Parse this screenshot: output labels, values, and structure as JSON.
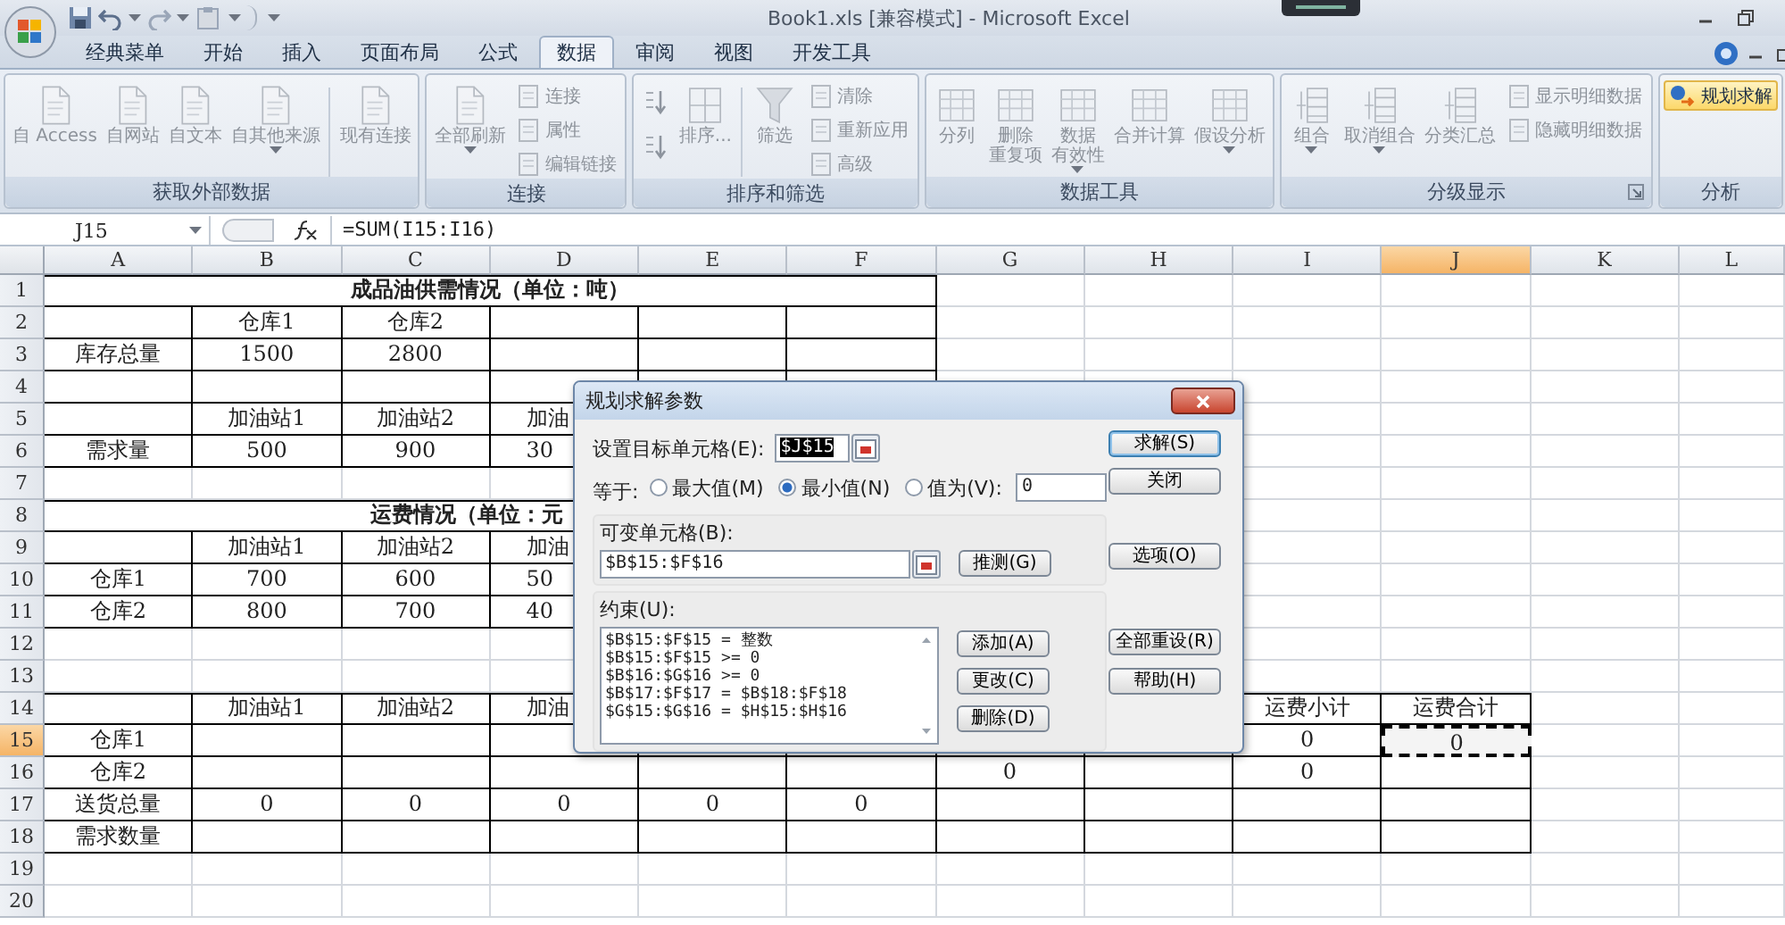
{
  "window": {
    "title": "Book1.xls  [兼容模式] - Microsoft Excel"
  },
  "tabs": [
    {
      "label": "经典菜单",
      "selected": false
    },
    {
      "label": "开始",
      "selected": false
    },
    {
      "label": "插入",
      "selected": false
    },
    {
      "label": "页面布局",
      "selected": false
    },
    {
      "label": "公式",
      "selected": false
    },
    {
      "label": "数据",
      "selected": true
    },
    {
      "label": "审阅",
      "selected": false
    },
    {
      "label": "视图",
      "selected": false
    },
    {
      "label": "开发工具",
      "selected": false
    }
  ],
  "ribbon_groups": [
    {
      "label": "获取外部数据",
      "launcher": false,
      "items": [
        {
          "kind": "large",
          "lines": [
            "自 Access"
          ],
          "disabled": true,
          "dropdown": false,
          "highlighted": false
        },
        {
          "kind": "large",
          "lines": [
            "自网站"
          ],
          "disabled": true,
          "dropdown": false,
          "highlighted": false
        },
        {
          "kind": "large",
          "lines": [
            "自文本"
          ],
          "disabled": true,
          "dropdown": false,
          "highlighted": false
        },
        {
          "kind": "large",
          "lines": [
            "自其他来源"
          ],
          "disabled": true,
          "dropdown": true,
          "highlighted": false
        },
        {
          "kind": "separator"
        },
        {
          "kind": "large",
          "lines": [
            "现有连接"
          ],
          "disabled": true,
          "dropdown": false,
          "highlighted": false
        }
      ]
    },
    {
      "label": "连接",
      "launcher": false,
      "items": [
        {
          "kind": "large",
          "lines": [
            "全部刷新"
          ],
          "disabled": true,
          "dropdown": true,
          "highlighted": false
        },
        {
          "kind": "small",
          "label": "连接",
          "disabled": true,
          "dropdown": false,
          "highlighted": false
        },
        {
          "kind": "small",
          "label": "属性",
          "disabled": true,
          "dropdown": false,
          "highlighted": false
        },
        {
          "kind": "small",
          "label": "编辑链接",
          "disabled": true,
          "dropdown": false,
          "highlighted": false
        }
      ]
    },
    {
      "label": "排序和筛选",
      "launcher": false,
      "items": [
        {
          "kind": "icon",
          "disabled": true,
          "highlighted": false
        },
        {
          "kind": "icon",
          "disabled": true,
          "highlighted": false
        },
        {
          "kind": "large",
          "lines": [
            "排序..."
          ],
          "disabled": true,
          "dropdown": false,
          "highlighted": false
        },
        {
          "kind": "separator"
        },
        {
          "kind": "large",
          "lines": [
            "筛选"
          ],
          "disabled": true,
          "dropdown": false,
          "highlighted": false
        },
        {
          "kind": "small",
          "label": "清除",
          "disabled": true,
          "dropdown": false,
          "highlighted": false
        },
        {
          "kind": "small",
          "label": "重新应用",
          "disabled": true,
          "dropdown": false,
          "highlighted": false
        },
        {
          "kind": "small",
          "label": "高级",
          "disabled": true,
          "dropdown": false,
          "highlighted": false
        }
      ]
    },
    {
      "label": "数据工具",
      "launcher": false,
      "items": [
        {
          "kind": "large",
          "lines": [
            "分列"
          ],
          "disabled": true,
          "dropdown": false,
          "highlighted": false
        },
        {
          "kind": "large",
          "lines": [
            "删除",
            "重复项"
          ],
          "disabled": true,
          "dropdown": false,
          "highlighted": false
        },
        {
          "kind": "large",
          "lines": [
            "数据",
            "有效性"
          ],
          "disabled": true,
          "dropdown": true,
          "highlighted": false
        },
        {
          "kind": "large",
          "lines": [
            "合并计算"
          ],
          "disabled": true,
          "dropdown": false,
          "highlighted": false
        },
        {
          "kind": "large",
          "lines": [
            "假设分析"
          ],
          "disabled": true,
          "dropdown": true,
          "highlighted": false
        }
      ]
    },
    {
      "label": "分级显示",
      "launcher": true,
      "items": [
        {
          "kind": "large",
          "lines": [
            "组合"
          ],
          "disabled": true,
          "dropdown": true,
          "highlighted": false
        },
        {
          "kind": "large",
          "lines": [
            "取消组合"
          ],
          "disabled": true,
          "dropdown": true,
          "highlighted": false
        },
        {
          "kind": "large",
          "lines": [
            "分类汇总"
          ],
          "disabled": true,
          "dropdown": false,
          "highlighted": false
        },
        {
          "kind": "small",
          "label": "显示明细数据",
          "disabled": true,
          "dropdown": false,
          "highlighted": false
        },
        {
          "kind": "small",
          "label": "隐藏明细数据",
          "disabled": true,
          "dropdown": false,
          "highlighted": false
        }
      ]
    },
    {
      "label": "分析",
      "launcher": false,
      "items": [
        {
          "kind": "small",
          "label": "规划求解",
          "disabled": false,
          "dropdown": false,
          "highlighted": true
        }
      ]
    }
  ],
  "name_box": "J15",
  "formula": "=SUM(I15:I16)",
  "columns": [
    {
      "label": "A",
      "selected": false
    },
    {
      "label": "B",
      "selected": false
    },
    {
      "label": "C",
      "selected": false
    },
    {
      "label": "D",
      "selected": false
    },
    {
      "label": "E",
      "selected": false
    },
    {
      "label": "F",
      "selected": false
    },
    {
      "label": "G",
      "selected": false
    },
    {
      "label": "H",
      "selected": false
    },
    {
      "label": "I",
      "selected": false
    },
    {
      "label": "J",
      "selected": true
    },
    {
      "label": "K",
      "selected": false
    },
    {
      "label": "L",
      "selected": false
    }
  ],
  "rows": [
    {
      "number": "1",
      "selected": false,
      "title": "成品油供需情况（单位：吨）"
    },
    {
      "number": "2",
      "selected": false,
      "cells": [
        null,
        {
          "text": "仓库1",
          "active": false
        },
        {
          "text": "仓库2",
          "active": false
        }
      ]
    },
    {
      "number": "3",
      "selected": false,
      "cells": [
        {
          "text": "库存总量",
          "active": false
        },
        {
          "text": "1500",
          "active": false
        },
        {
          "text": "2800",
          "active": false
        }
      ]
    },
    {
      "number": "4",
      "selected": false
    },
    {
      "number": "5",
      "selected": false,
      "cells": [
        null,
        {
          "text": "加油站1",
          "active": false
        },
        {
          "text": "加油站2",
          "active": false
        },
        {
          "text": "加油",
          "active": false
        }
      ]
    },
    {
      "number": "6",
      "selected": false,
      "cells": [
        {
          "text": "需求量",
          "active": false
        },
        {
          "text": "500",
          "active": false
        },
        {
          "text": "900",
          "active": false
        },
        {
          "text": "30",
          "active": false
        }
      ]
    },
    {
      "number": "7",
      "selected": false
    },
    {
      "number": "8",
      "selected": false,
      "title": "运费情况（单位：元"
    },
    {
      "number": "9",
      "selected": false,
      "cells": [
        null,
        {
          "text": "加油站1",
          "active": false
        },
        {
          "text": "加油站2",
          "active": false
        },
        {
          "text": "加油",
          "active": false
        }
      ]
    },
    {
      "number": "10",
      "selected": false,
      "cells": [
        {
          "text": "仓库1",
          "active": false
        },
        {
          "text": "700",
          "active": false
        },
        {
          "text": "600",
          "active": false
        },
        {
          "text": "50",
          "active": false
        }
      ]
    },
    {
      "number": "11",
      "selected": false,
      "cells": [
        {
          "text": "仓库2",
          "active": false
        },
        {
          "text": "800",
          "active": false
        },
        {
          "text": "700",
          "active": false
        },
        {
          "text": "40",
          "active": false
        }
      ]
    },
    {
      "number": "12",
      "selected": false
    },
    {
      "number": "13",
      "selected": false
    },
    {
      "number": "14",
      "selected": false,
      "cells": [
        null,
        {
          "text": "加油站1",
          "active": false
        },
        {
          "text": "加油站2",
          "active": false
        },
        {
          "text": "加油",
          "active": false
        },
        null,
        null,
        null,
        null,
        {
          "text": "运费小计",
          "active": false
        },
        {
          "text": "运费合计",
          "active": false
        }
      ]
    },
    {
      "number": "15",
      "selected": true,
      "cells": [
        {
          "text": "仓库1",
          "active": false
        },
        null,
        null,
        null,
        null,
        null,
        null,
        null,
        {
          "text": "0",
          "active": false
        },
        {
          "text": "0",
          "active": true
        }
      ]
    },
    {
      "number": "16",
      "selected": false,
      "cells": [
        {
          "text": "仓库2",
          "active": false
        },
        null,
        null,
        null,
        null,
        null,
        {
          "text": "0",
          "active": false
        },
        null,
        {
          "text": "0",
          "active": false
        }
      ]
    },
    {
      "number": "17",
      "selected": false,
      "cells": [
        {
          "text": "送货总量",
          "active": false
        },
        {
          "text": "0",
          "active": false
        },
        {
          "text": "0",
          "active": false
        },
        {
          "text": "0",
          "active": false
        },
        {
          "text": "0",
          "active": false
        },
        {
          "text": "0",
          "active": false
        }
      ]
    },
    {
      "number": "18",
      "selected": false,
      "cells": [
        {
          "text": "需求数量",
          "active": false
        }
      ]
    },
    {
      "number": "19",
      "selected": false
    },
    {
      "number": "20",
      "selected": false
    }
  ],
  "dialog": {
    "title": "规划求解参数",
    "target_label": "设置目标单元格(E):",
    "target_value": "$J$15",
    "equals_label": "等于:",
    "options": [
      {
        "label": "最大值(M)",
        "selected": false
      },
      {
        "label": "最小值(N)",
        "selected": true
      },
      {
        "label": "值为(V):",
        "selected": false
      }
    ],
    "value": "0",
    "changing_label": "可变单元格(B):",
    "changing_value": "$B$15:$F$16",
    "guess_button": "推测(G)",
    "constraints_label": "约束(U):",
    "constraints": [
      "$B$15:$F$15 = 整数",
      "$B$15:$F$15 >= 0",
      "$B$16:$G$16 >= 0",
      "$B$17:$F$17 = $B$18:$F$18",
      "$G$15:$G$16 = $H$15:$H$16"
    ],
    "constraint_buttons": [
      "添加(A)",
      "更改(C)",
      "删除(D)"
    ],
    "side_buttons": [
      "求解(S)",
      "关闭",
      "选项(O)",
      "全部重设(R)",
      "帮助(H)"
    ]
  }
}
